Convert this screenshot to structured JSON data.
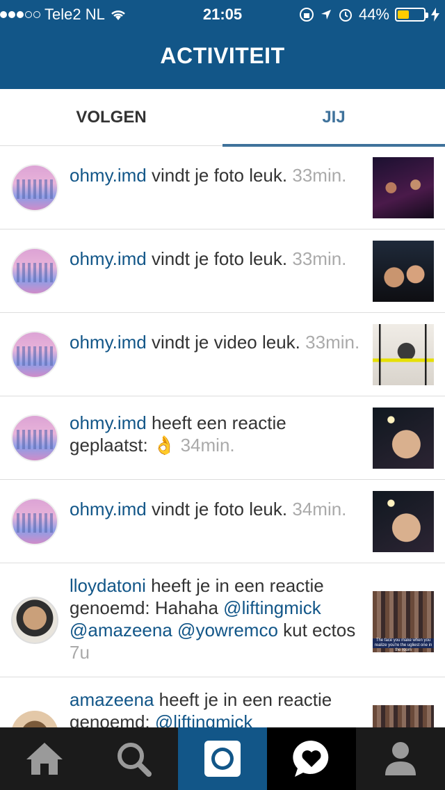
{
  "status": {
    "carrier": "Tele2 NL",
    "time": "21:05",
    "battery": "44%",
    "battery_fraction": 0.44
  },
  "header": {
    "title": "ACTIVITEIT"
  },
  "tabs": {
    "left": "VOLGEN",
    "right": "JIJ"
  },
  "activities": [
    {
      "user": "ohmy.imd",
      "text": " vindt je foto leuk.",
      "time": "33min."
    },
    {
      "user": "ohmy.imd",
      "text": " vindt je foto leuk.",
      "time": "33min."
    },
    {
      "user": "ohmy.imd",
      "text": " vindt je video leuk.",
      "time": "33min."
    },
    {
      "user": "ohmy.imd",
      "text": " heeft een reactie geplaatst: ",
      "emoji": "👌",
      "time": "34min."
    },
    {
      "user": "ohmy.imd",
      "text": " vindt je foto leuk.",
      "time": "34min."
    },
    {
      "user": "lloydatoni",
      "text1": " heeft je in een reactie genoemd: Hahaha ",
      "mention1": "@liftingmick",
      "mention2": "@amazeena",
      "mention3": "@yowremco",
      "text2": " kut ectos ",
      "time": "7u",
      "caption": "The face you make when you realize you're the ugliest one in the room"
    },
    {
      "user": "amazeena",
      "text": " heeft je in een reactie genoemd: ",
      "mention": "@liftingmick"
    }
  ],
  "icons": {
    "home": "home-icon",
    "search": "search-icon",
    "camera": "camera-icon",
    "activity": "heart-bubble-icon",
    "profile": "profile-icon"
  },
  "colors": {
    "brand": "#125688",
    "accent": "#3f729b",
    "tabbar": "#1b1b1b"
  }
}
